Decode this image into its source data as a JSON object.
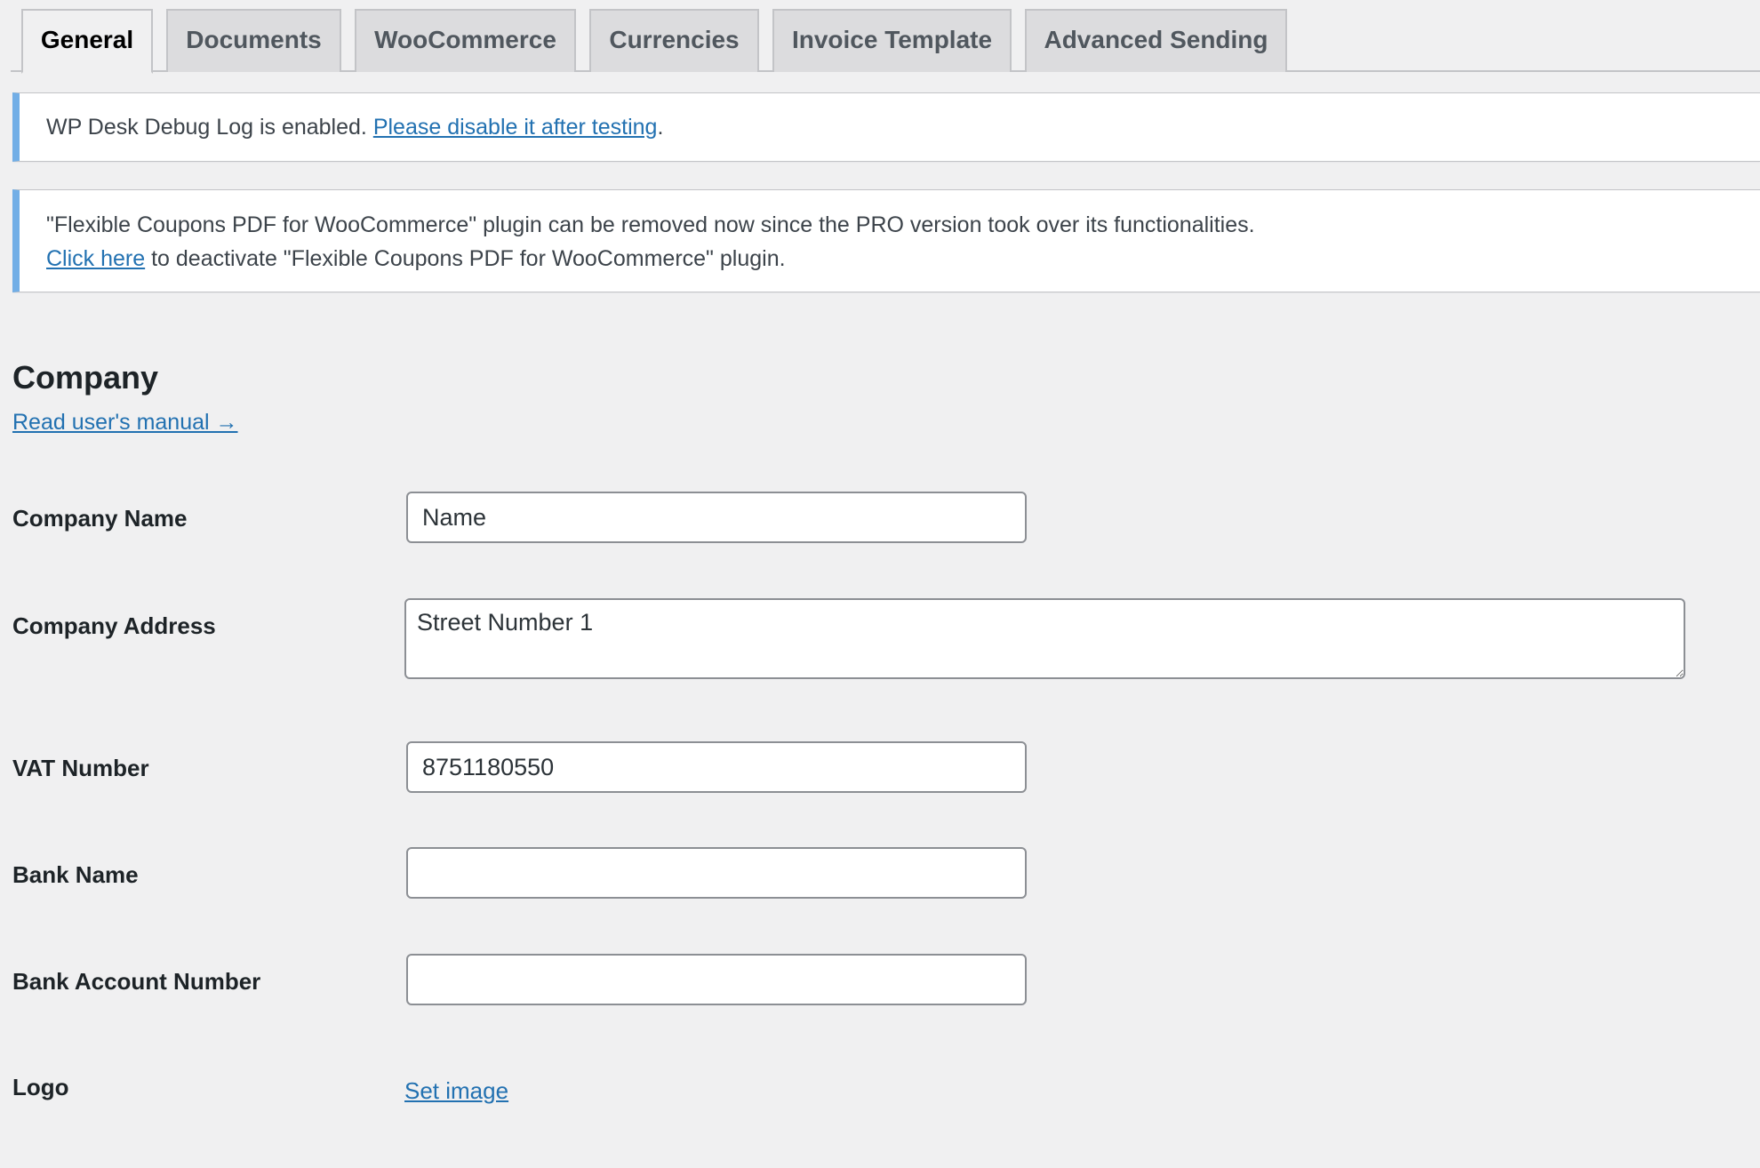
{
  "tabs": [
    {
      "label": "General",
      "active": true
    },
    {
      "label": "Documents",
      "active": false
    },
    {
      "label": "WooCommerce",
      "active": false
    },
    {
      "label": "Currencies",
      "active": false
    },
    {
      "label": "Invoice Template",
      "active": false
    },
    {
      "label": "Advanced Sending",
      "active": false
    }
  ],
  "notices": {
    "debug": {
      "text": "WP Desk Debug Log is enabled. ",
      "link_label": "Please disable it after testing",
      "suffix": "."
    },
    "plugin": {
      "line1": "\"Flexible Coupons PDF for WooCommerce\" plugin can be removed now since the PRO version took over its functionalities.",
      "link_label": "Click here",
      "line2_rest": " to deactivate \"Flexible Coupons PDF for WooCommerce\" plugin."
    }
  },
  "section": {
    "title": "Company",
    "manual_link": "Read user's manual →"
  },
  "form": {
    "company_name": {
      "label": "Company Name",
      "value": "Name",
      "placeholder": ""
    },
    "company_address": {
      "label": "Company Address",
      "value": "Street Number 1"
    },
    "vat_number": {
      "label": "VAT Number",
      "value": "8751180550",
      "placeholder": ""
    },
    "bank_name": {
      "label": "Bank Name",
      "value": "",
      "placeholder": ""
    },
    "bank_account_number": {
      "label": "Bank Account Number",
      "value": "",
      "placeholder": ""
    },
    "logo": {
      "label": "Logo",
      "action_label": "Set image"
    }
  },
  "colors": {
    "background": "#f0f0f1",
    "link": "#2271b1",
    "notice_accent": "#72aee6",
    "tab_inactive_bg": "#dcdcde",
    "input_border": "#8c8f94"
  }
}
